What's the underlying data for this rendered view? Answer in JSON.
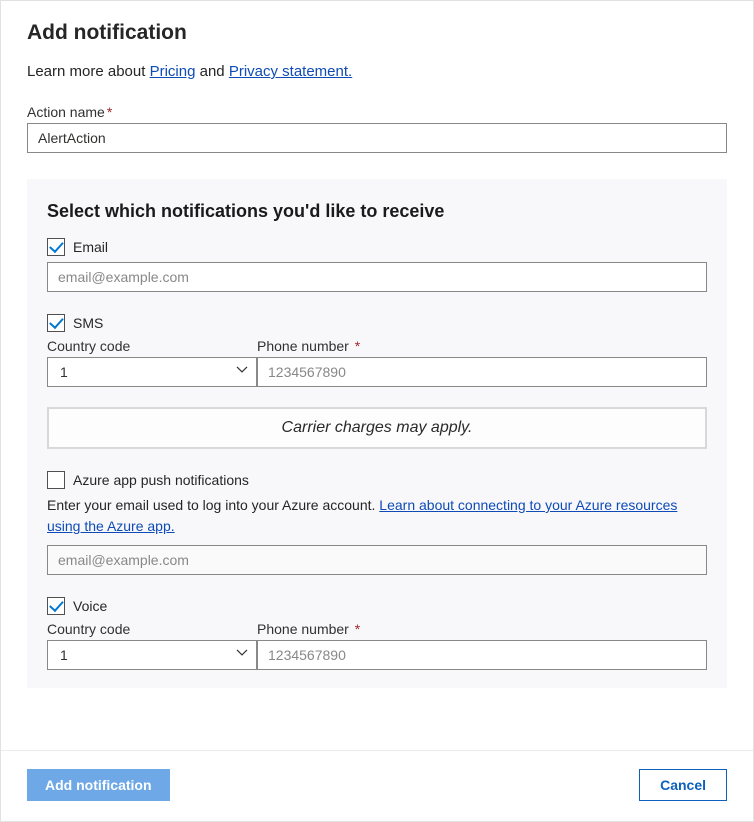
{
  "header": {
    "title": "Add notification",
    "learn_more_prefix": "Learn more about ",
    "pricing_link": "Pricing",
    "and_text": " and ",
    "privacy_link": " Privacy statement."
  },
  "action_name": {
    "label": "Action name",
    "value": "AlertAction"
  },
  "panel": {
    "title": "Select which notifications you'd like to receive",
    "email": {
      "label": "Email",
      "checked": true,
      "placeholder": "email@example.com",
      "value": ""
    },
    "sms": {
      "label": "SMS",
      "checked": true,
      "country_label": "Country code",
      "country_value": "1",
      "phone_label": "Phone number",
      "phone_placeholder": "1234567890",
      "phone_value": "",
      "carrier_notice": "Carrier charges may apply."
    },
    "azure_app": {
      "label": "Azure app push notifications",
      "checked": false,
      "helper_text": "Enter your email used to log into your Azure account. ",
      "helper_link": "Learn about connecting to your Azure resources using the Azure app.",
      "placeholder": "email@example.com",
      "value": ""
    },
    "voice": {
      "label": "Voice",
      "checked": true,
      "country_label": "Country code",
      "country_value": "1",
      "phone_label": "Phone number",
      "phone_placeholder": "1234567890",
      "phone_value": ""
    }
  },
  "footer": {
    "primary": "Add notification",
    "secondary": "Cancel"
  }
}
